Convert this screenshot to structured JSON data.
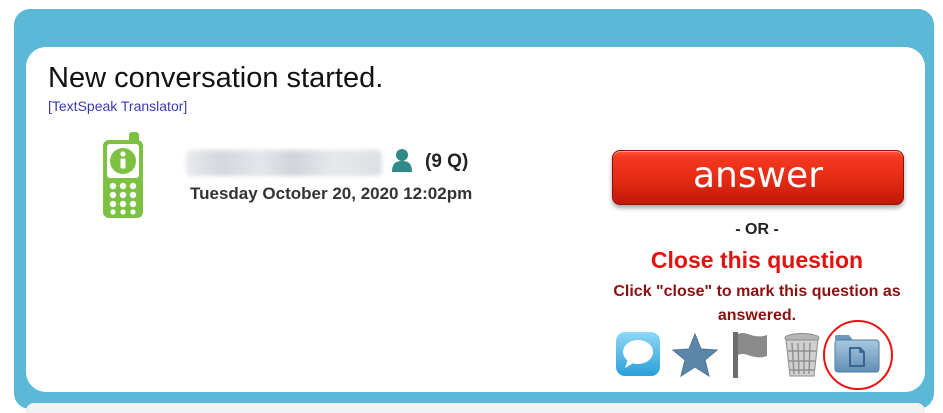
{
  "header": {
    "title": "New conversation started.",
    "translator_link": "[TextSpeak Translator]"
  },
  "conversation": {
    "question_count": "(9 Q)",
    "timestamp": "Tuesday October 20, 2020 12:02pm",
    "contact_icon": "mobile-phone-icon",
    "user_icon": "person-icon"
  },
  "actions": {
    "answer_label": "answer",
    "or_label": "- OR -",
    "close_label": "Close this question",
    "close_instructions": "Click \"close\" to mark this question as answered.",
    "icons": [
      "speech-bubble-icon",
      "star-icon",
      "flag-icon",
      "trash-icon",
      "folder-icon"
    ]
  },
  "colors": {
    "frame": "#5bb8d6",
    "answer_button": "#e42a13",
    "close_link": "#e0130f",
    "instructions": "#8b1111",
    "phone_icon": "#7cc142",
    "highlight_circle": "#e11111"
  }
}
